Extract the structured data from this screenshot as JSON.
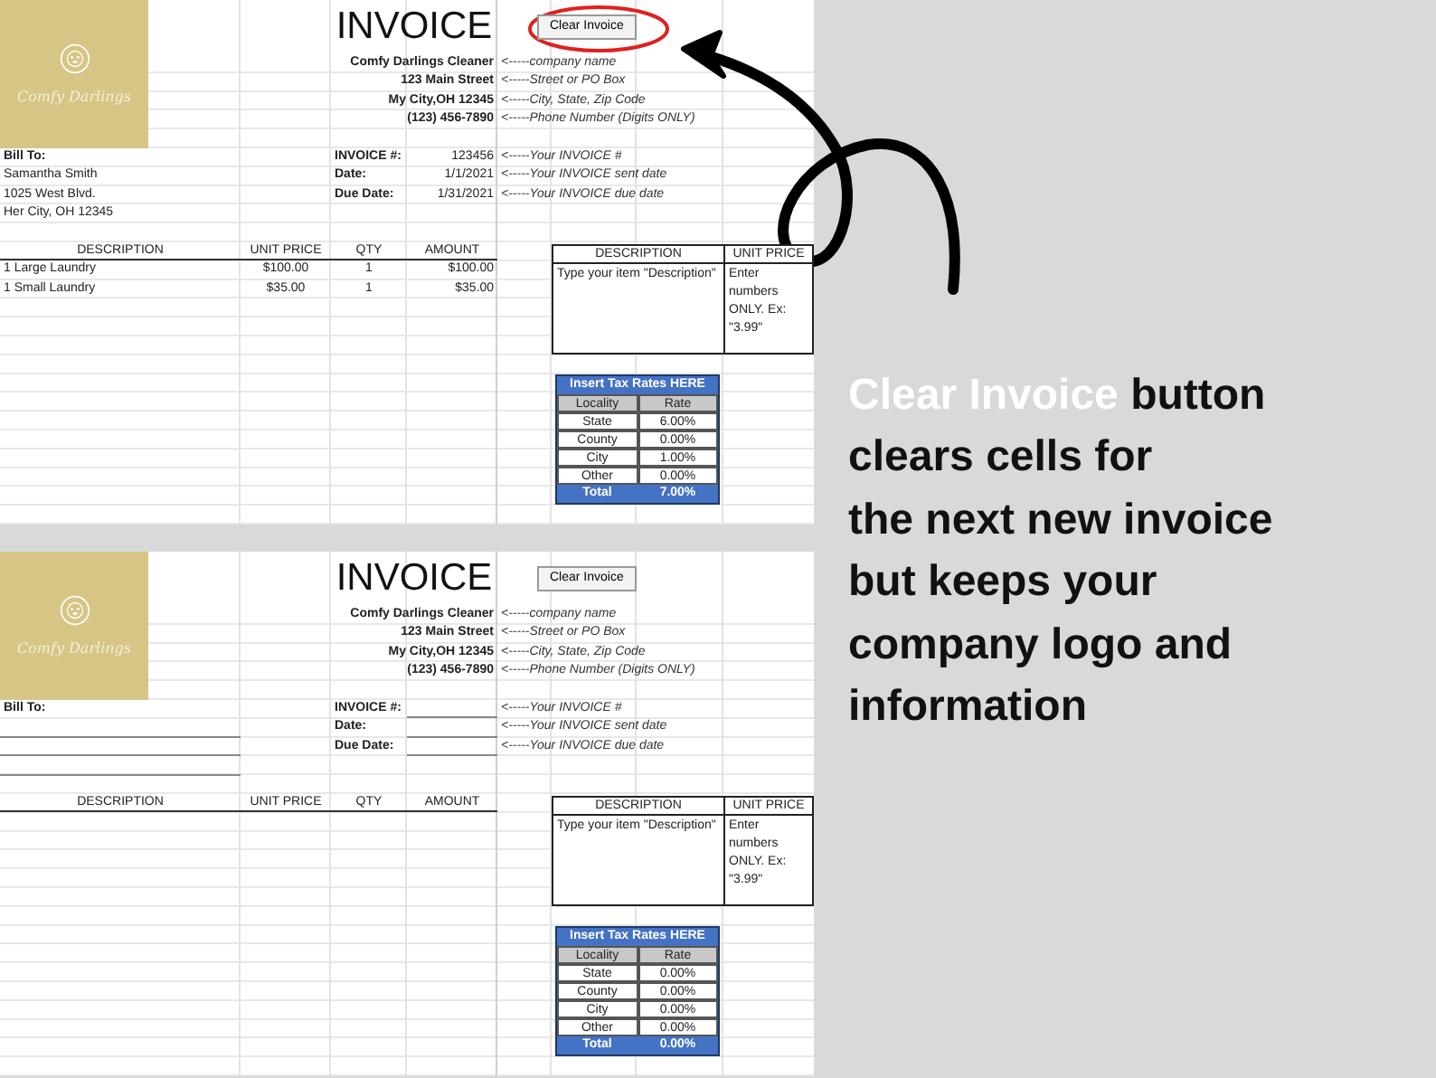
{
  "sheets": [
    {
      "title": "INVOICE",
      "clear_button": {
        "label": "Clear Invoice",
        "circled": true
      },
      "logo_text": "Comfy Darlings",
      "company": [
        {
          "value": "Comfy Darlings Cleaner",
          "hint": "<-----company name"
        },
        {
          "value": "123 Main Street",
          "hint": "<-----Street or PO Box"
        },
        {
          "value": "My City,OH 12345",
          "hint": "<-----City, State, Zip Code"
        },
        {
          "value": "(123) 456-7890",
          "hint": "<-----Phone Number (Digits ONLY)"
        }
      ],
      "bill_to": {
        "label": "Bill To:",
        "lines": [
          "Samantha Smith",
          "1025 West Blvd.",
          "Her City, OH 12345"
        ]
      },
      "invoice_fields": [
        {
          "label": "INVOICE #:",
          "value": "123456",
          "hint": "<-----Your INVOICE #"
        },
        {
          "label": "Date:",
          "value": "1/1/2021",
          "hint": "<-----Your INVOICE sent date"
        },
        {
          "label": "Due Date:",
          "value": "1/31/2021",
          "hint": "<-----Your INVOICE due date"
        }
      ],
      "items": {
        "columns": [
          "DESCRIPTION",
          "UNIT PRICE",
          "QTY",
          "AMOUNT"
        ],
        "rows": [
          {
            "description": "1 Large Laundry",
            "unit_price": "$100.00",
            "qty": "1",
            "amount": "$100.00"
          },
          {
            "description": "1 Small Laundry",
            "unit_price": "$35.00",
            "qty": "1",
            "amount": "$35.00"
          }
        ]
      },
      "help_box": {
        "columns": [
          "DESCRIPTION",
          "UNIT PRICE"
        ],
        "cells": [
          "Type your item \"Description\"",
          "Enter numbers ONLY.  Ex: \"3.99\""
        ]
      },
      "tax_table": {
        "title": "Insert Tax Rates HERE",
        "columns": [
          "Locality",
          "Rate"
        ],
        "rows": [
          {
            "locality": "State",
            "rate": "6.00%"
          },
          {
            "locality": "County",
            "rate": "0.00%"
          },
          {
            "locality": "City",
            "rate": "1.00%"
          },
          {
            "locality": "Other",
            "rate": "0.00%"
          }
        ],
        "total": {
          "label": "Total",
          "rate": "7.00%"
        }
      }
    },
    {
      "title": "INVOICE",
      "clear_button": {
        "label": "Clear Invoice",
        "circled": false
      },
      "logo_text": "Comfy Darlings",
      "company": [
        {
          "value": "Comfy Darlings Cleaner",
          "hint": "<-----company name"
        },
        {
          "value": "123 Main Street",
          "hint": "<-----Street or PO Box"
        },
        {
          "value": "My City,OH 12345",
          "hint": "<-----City, State, Zip Code"
        },
        {
          "value": "(123) 456-7890",
          "hint": "<-----Phone Number (Digits ONLY)"
        }
      ],
      "bill_to": {
        "label": "Bill To:"
      },
      "invoice_fields": [
        {
          "label": "INVOICE #:",
          "hint": "<-----Your INVOICE #"
        },
        {
          "label": "Date:",
          "hint": "<-----Your INVOICE sent date"
        },
        {
          "label": "Due Date:",
          "hint": "<-----Your INVOICE due date"
        }
      ],
      "items": {
        "columns": [
          "DESCRIPTION",
          "UNIT PRICE",
          "QTY",
          "AMOUNT"
        ]
      },
      "help_box": {
        "columns": [
          "DESCRIPTION",
          "UNIT PRICE"
        ],
        "cells": [
          "Type your item \"Description\"",
          "Enter numbers ONLY.  Ex: \"3.99\""
        ]
      },
      "tax_table": {
        "title": "Insert Tax Rates HERE",
        "columns": [
          "Locality",
          "Rate"
        ],
        "rows": [
          {
            "locality": "State",
            "rate": "0.00%"
          },
          {
            "locality": "County",
            "rate": "0.00%"
          },
          {
            "locality": "City",
            "rate": "0.00%"
          },
          {
            "locality": "Other",
            "rate": "0.00%"
          }
        ],
        "total": {
          "label": "Total",
          "rate": "0.00%"
        }
      }
    }
  ],
  "caption": {
    "highlighted_text": "Clear Invoice",
    "lines": [
      " button",
      "clears cells for",
      "the next new invoice",
      "but keeps your",
      "company logo and",
      "information"
    ]
  }
}
